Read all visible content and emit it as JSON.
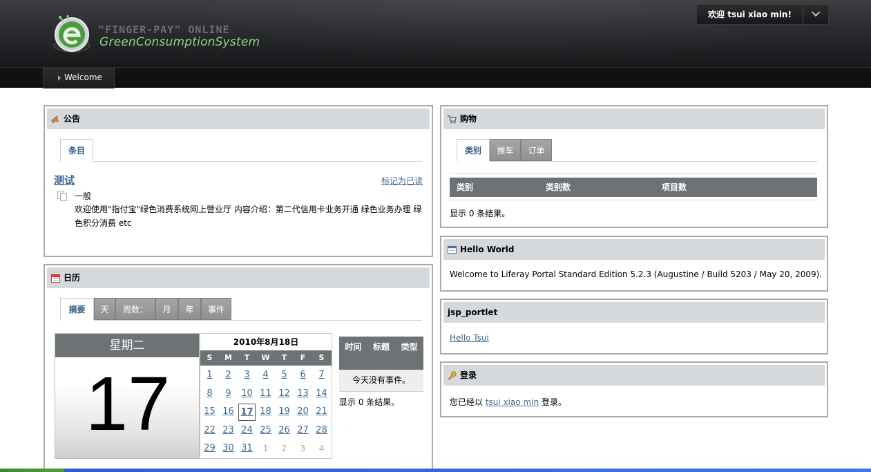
{
  "header": {
    "logo_line1": "\"FINGER-PAY\" ONLINE",
    "logo_line2": "GreenConsumptionSystem",
    "user_label": "欢迎 tsui xiao min!",
    "dock_toggle_icon": "chevron-down-icon"
  },
  "nav": {
    "items": [
      {
        "label": "Welcome"
      }
    ]
  },
  "announcements": {
    "title": "公告",
    "tab": "条目",
    "entry_title": "测试",
    "mark_read": "标记为已读",
    "category": "一般",
    "content": "欢迎使用\"指付宝\"绿色消费系统网上营业厅 内容介绍：第二代信用卡业务开通 绿色业务办理 绿色积分消费 etc"
  },
  "calendar": {
    "title": "日历",
    "tabs": [
      "摘要",
      "天",
      "周数：",
      "月",
      "年",
      "事件"
    ],
    "weekday": "星期二",
    "day": "17",
    "month_title": "2010年8月18日",
    "dow_labels": [
      "S",
      "M",
      "T",
      "W",
      "T",
      "F",
      "S"
    ],
    "weeks": [
      [
        "1",
        "2",
        "3",
        "4",
        "5",
        "6",
        "7"
      ],
      [
        "8",
        "9",
        "10",
        "11",
        "12",
        "13",
        "14"
      ],
      [
        "15",
        "16",
        "17",
        "18",
        "19",
        "20",
        "21"
      ],
      [
        "22",
        "23",
        "24",
        "25",
        "26",
        "27",
        "28"
      ],
      [
        "29",
        "30",
        "31",
        "1",
        "2",
        "3",
        "4"
      ]
    ],
    "today": "17",
    "events_headers": [
      "时间",
      "标题",
      "类型"
    ],
    "no_events": "今天没有事件。",
    "results": "显示 0 条结果。"
  },
  "shopping": {
    "title": "购物",
    "tabs": [
      "类别",
      "推车",
      "订单"
    ],
    "columns": [
      "类别",
      "类别数",
      "项目数"
    ],
    "results": "显示 0 条结果。"
  },
  "hello_world": {
    "title": "Hello World",
    "text": "Welcome to Liferay Portal Standard Edition 5.2.3 (Augustine / Build 5203 / May 20, 2009)."
  },
  "jsp_portlet": {
    "title": "jsp_portlet",
    "link": "Hello Tsui"
  },
  "login": {
    "title": "登录",
    "prefix": "您已经以",
    "user": "tsui xiao min",
    "suffix": "登录。"
  }
}
